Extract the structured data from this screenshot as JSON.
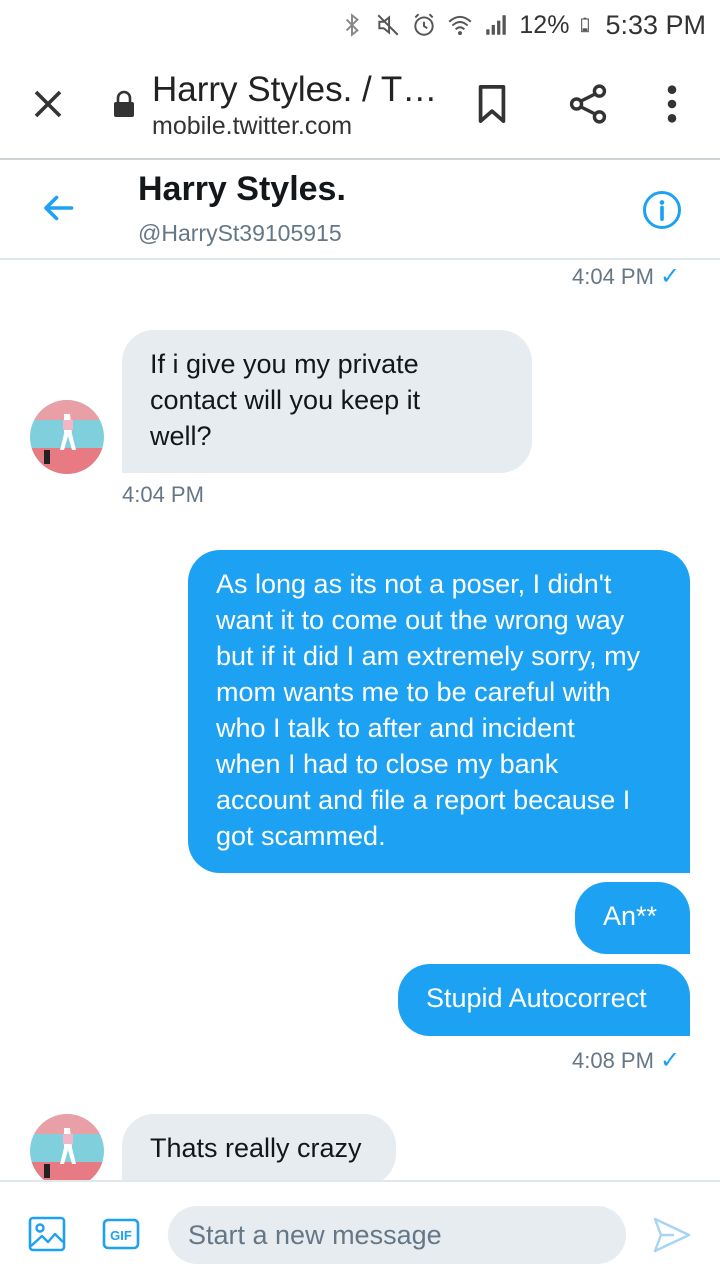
{
  "status_bar": {
    "battery_percent": "12%",
    "time": "5:33 PM",
    "icons": [
      "bluetooth-icon",
      "mute-icon",
      "alarm-icon",
      "wifi-icon",
      "signal-icon",
      "battery-icon"
    ]
  },
  "browser": {
    "page_title": "Harry Styles. / T…",
    "url": "mobile.twitter.com",
    "icons": [
      "close-icon",
      "lock-icon",
      "bookmark-icon",
      "share-icon",
      "more-vert-icon"
    ]
  },
  "conversation": {
    "name": "Harry Styles.",
    "handle": "@HarrySt39105915",
    "icons": [
      "back-arrow-icon",
      "info-icon"
    ]
  },
  "messages": {
    "top_time": "4:04 PM",
    "m1": {
      "lines": [
        "If i give you my private",
        "contact will you keep it",
        "well?"
      ],
      "time": "4:04 PM"
    },
    "m2": {
      "lines": [
        "As long as its not a poser, I didn't",
        "want it to come out the wrong way",
        "but if it did I am extremely sorry, my",
        "mom wants me to be careful with",
        "who I talk to after and incident",
        "when I had to close my bank",
        "account and file a report because I",
        "got scammed."
      ]
    },
    "m3": {
      "text": "An**"
    },
    "m4": {
      "text": "Stupid Autocorrect",
      "time": "4:08 PM"
    },
    "m5": {
      "text": "Thats really crazy"
    }
  },
  "compose": {
    "placeholder": "Start a new message",
    "gif_label": "GIF",
    "icons": [
      "image-icon",
      "gif-icon",
      "send-icon"
    ]
  },
  "colors": {
    "accent": "#1da1f2",
    "incoming_bubble": "#e6ecf0",
    "secondary_text": "#657786"
  }
}
